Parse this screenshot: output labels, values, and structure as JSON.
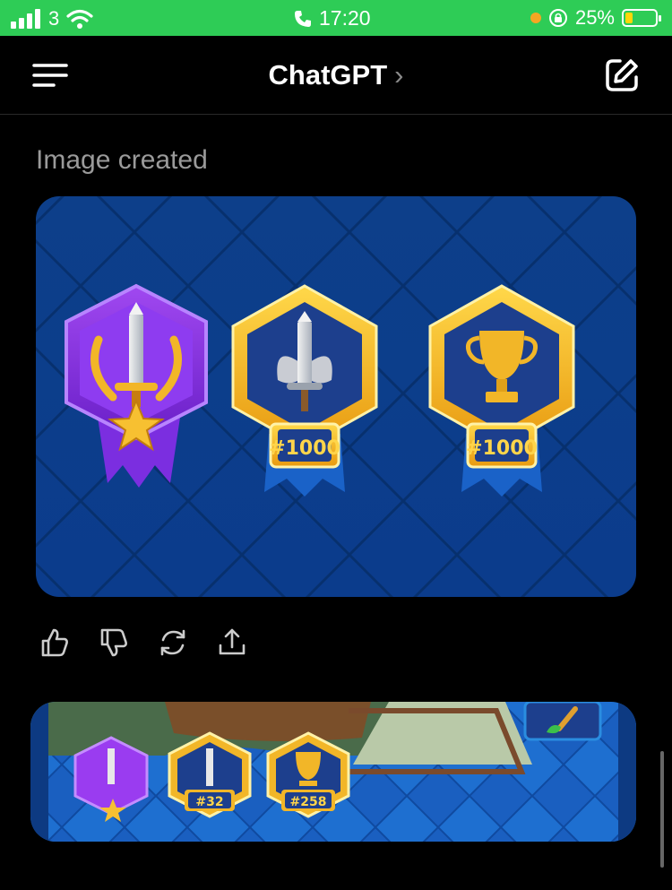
{
  "status_bar": {
    "carrier": "3",
    "time": "17:20",
    "battery_percent": "25%",
    "battery_level": 0.25,
    "colors": {
      "background": "#2ecc56",
      "battery_fill": "#ffd60a",
      "privacy_dot": "#f5a623"
    }
  },
  "nav": {
    "title": "ChatGPT",
    "chevron": "›",
    "menu_icon": "menu-icon",
    "edit_icon": "compose-icon"
  },
  "message": {
    "caption": "Image created",
    "image_badges": [
      {
        "style": "purple-shield",
        "emblem": "sword-laurel",
        "label": ""
      },
      {
        "style": "gold-hexagon",
        "emblem": "winged-sword",
        "label": "#1000"
      },
      {
        "style": "gold-hexagon",
        "emblem": "trophy",
        "label": "#1000"
      }
    ],
    "actions": [
      "thumbs-up-icon",
      "thumbs-down-icon",
      "regenerate-icon",
      "share-icon"
    ]
  },
  "next_image": {
    "badges": [
      {
        "style": "purple-shield",
        "label": ""
      },
      {
        "style": "gold-hexagon",
        "label": "#32"
      },
      {
        "style": "gold-hexagon",
        "label": "#258"
      }
    ]
  }
}
